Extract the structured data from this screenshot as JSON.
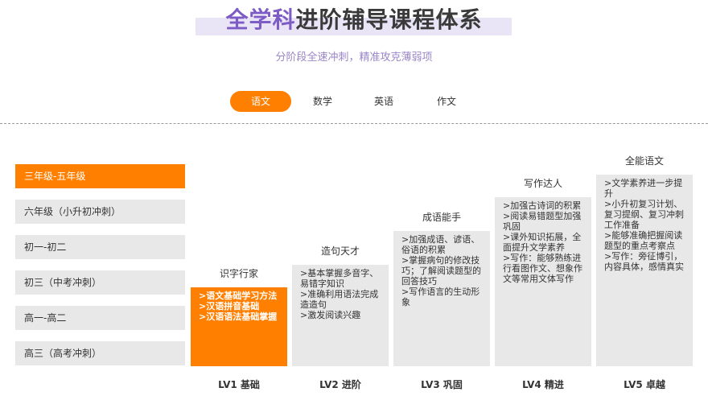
{
  "header": {
    "title_accent": "全学科",
    "title_rest": "进阶辅导课程体系",
    "subtitle": "分阶段全速冲刺，精准攻克薄弱项"
  },
  "tabs": [
    {
      "label": "语文",
      "active": true
    },
    {
      "label": "数学",
      "active": false
    },
    {
      "label": "英语",
      "active": false
    },
    {
      "label": "作文",
      "active": false
    }
  ],
  "grades": [
    {
      "label": "三年级-五年级",
      "active": true
    },
    {
      "label": "六年级（小升初冲刺）",
      "active": false
    },
    {
      "label": "初一-初二",
      "active": false
    },
    {
      "label": "初三（中考冲刺）",
      "active": false
    },
    {
      "label": "高一-高二",
      "active": false
    },
    {
      "label": "高三（高考冲刺）",
      "active": false
    }
  ],
  "levels": [
    {
      "name": "识字行家",
      "level": "LV1 基础",
      "points": [
        ">语文基础学习方法",
        ">汉语拼音基础",
        ">汉语语法基础掌握"
      ]
    },
    {
      "name": "造句天才",
      "level": "LV2 进阶",
      "points": [
        ">基本掌握多音字、易错字知识",
        ">准确利用语法完成造造句",
        ">激发阅读兴趣"
      ]
    },
    {
      "name": "成语能手",
      "level": "LV3 巩固",
      "points": [
        ">加强成语、谚语、俗语的积累",
        ">掌握病句的修改技巧；了解阅读题型的回答技巧",
        ">写作语言的生动形象"
      ]
    },
    {
      "name": "写作达人",
      "level": "LV4 精进",
      "points": [
        ">加强古诗词的积累",
        ">阅读易错题型加强巩固",
        ">课外知识拓展，全面提升文学素养",
        ">写作：能够熟练进行看图作文、想象作文等常用文体写作"
      ]
    },
    {
      "name": "全能语文",
      "level": "LV5 卓越",
      "points": [
        ">文学素养进一步提升",
        ">小升初复习计划、复习提纲、复习冲刺工作准备",
        ">能够准确把握阅读题型的重点考察点",
        ">写作：旁征博引，内容具体，感情真实"
      ]
    }
  ],
  "colors": {
    "accent": "#ff7f00",
    "title_accent": "#7d5cc6",
    "box_bg": "#e8e8e8"
  }
}
